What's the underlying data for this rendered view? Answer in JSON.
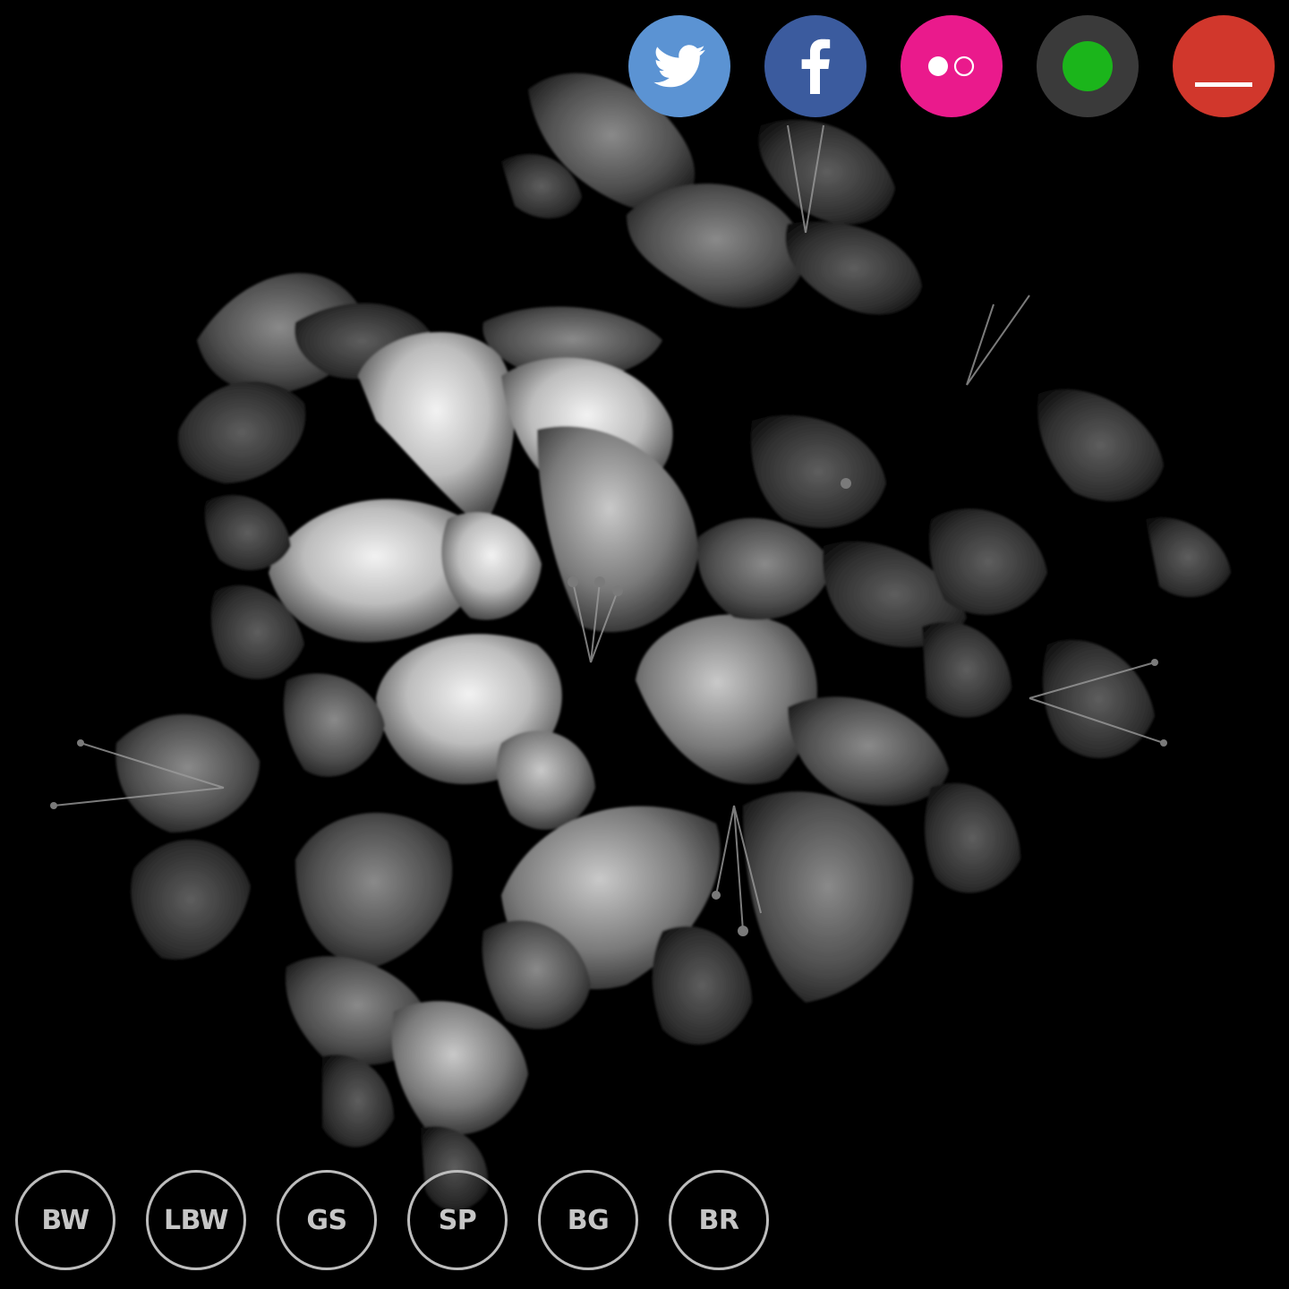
{
  "social": {
    "twitter": {
      "icon": "twitter-bird-icon",
      "color": "#5b93d3"
    },
    "facebook": {
      "icon": "facebook-f-icon",
      "color": "#3b5b9e"
    },
    "flickr": {
      "icon": "flickr-dots-icon",
      "color": "#ea1a8c"
    },
    "status": {
      "icon": "green-dot-icon",
      "color": "#3a3a3a",
      "dot": "#1bb51b"
    },
    "minimize": {
      "icon": "minimize-line-icon",
      "color": "#d1372c"
    }
  },
  "filters": [
    {
      "label": "BW"
    },
    {
      "label": "LBW"
    },
    {
      "label": "GS"
    },
    {
      "label": "SP"
    },
    {
      "label": "BG"
    },
    {
      "label": "BR"
    }
  ],
  "photo": {
    "subject": "lilies-monochrome"
  }
}
